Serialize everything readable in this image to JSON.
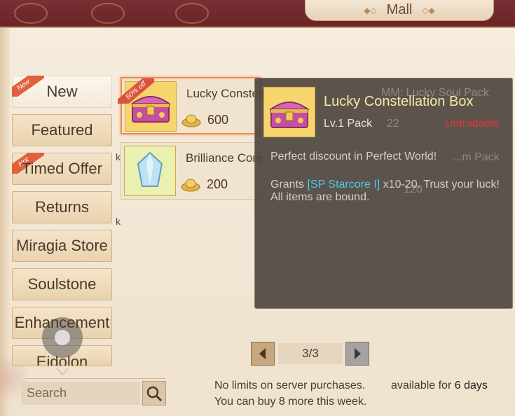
{
  "window": {
    "title": "Mall"
  },
  "tabs": [
    {
      "label": "New",
      "badge": "New",
      "active": true
    },
    {
      "label": "Featured"
    },
    {
      "label": "Timed Offer",
      "badge": "Hot"
    },
    {
      "label": "Returns"
    },
    {
      "label": "Miragia Store"
    },
    {
      "label": "Soulstone"
    },
    {
      "label": "Enhancement"
    },
    {
      "label": "Eidolon"
    }
  ],
  "items": [
    {
      "name": "Lucky Constellation Box",
      "price": "600",
      "discount": "50% off",
      "selected": true
    },
    {
      "name": "Brilliance Core",
      "price": "200"
    }
  ],
  "tooltip": {
    "name": "Lucky Constellation Box",
    "level": "Lv.1 Pack",
    "tradable": "Untradable",
    "flavor": "Perfect discount in Perfect World!",
    "grant_prefix": "Grants ",
    "grant_item": "[SP Starcore I]",
    "grant_suffix": " x10-20. Trust your luck!",
    "bound": "All items are bound.",
    "behind_items": [
      {
        "name": "MM: Lucky Soul Pack",
        "price": "22"
      },
      {
        "name": "...m Pack",
        "price": "120"
      }
    ]
  },
  "pager": {
    "label": "3/3"
  },
  "search": {
    "placeholder": "Search"
  },
  "footer": {
    "limit_text": "No limits on server purchases.",
    "availability_prefix": "available for ",
    "availability_value": "6 days",
    "weekly_limit": "You can buy 8 more this week."
  },
  "stray_text": "k",
  "colors": {
    "header_bg": "#7a2f33",
    "accent": "#ef8a52",
    "tooltip_title": "#f6e8a6",
    "untradable": "#e0343a",
    "item_highlight": "#4fc7e8"
  },
  "icons": {
    "chest": "treasure-chest-icon",
    "crystal": "crystal-core-icon",
    "currency": "gold-ingot-icon",
    "search": "magnifier-icon",
    "prev": "chevron-left-icon",
    "next": "chevron-right-icon"
  }
}
